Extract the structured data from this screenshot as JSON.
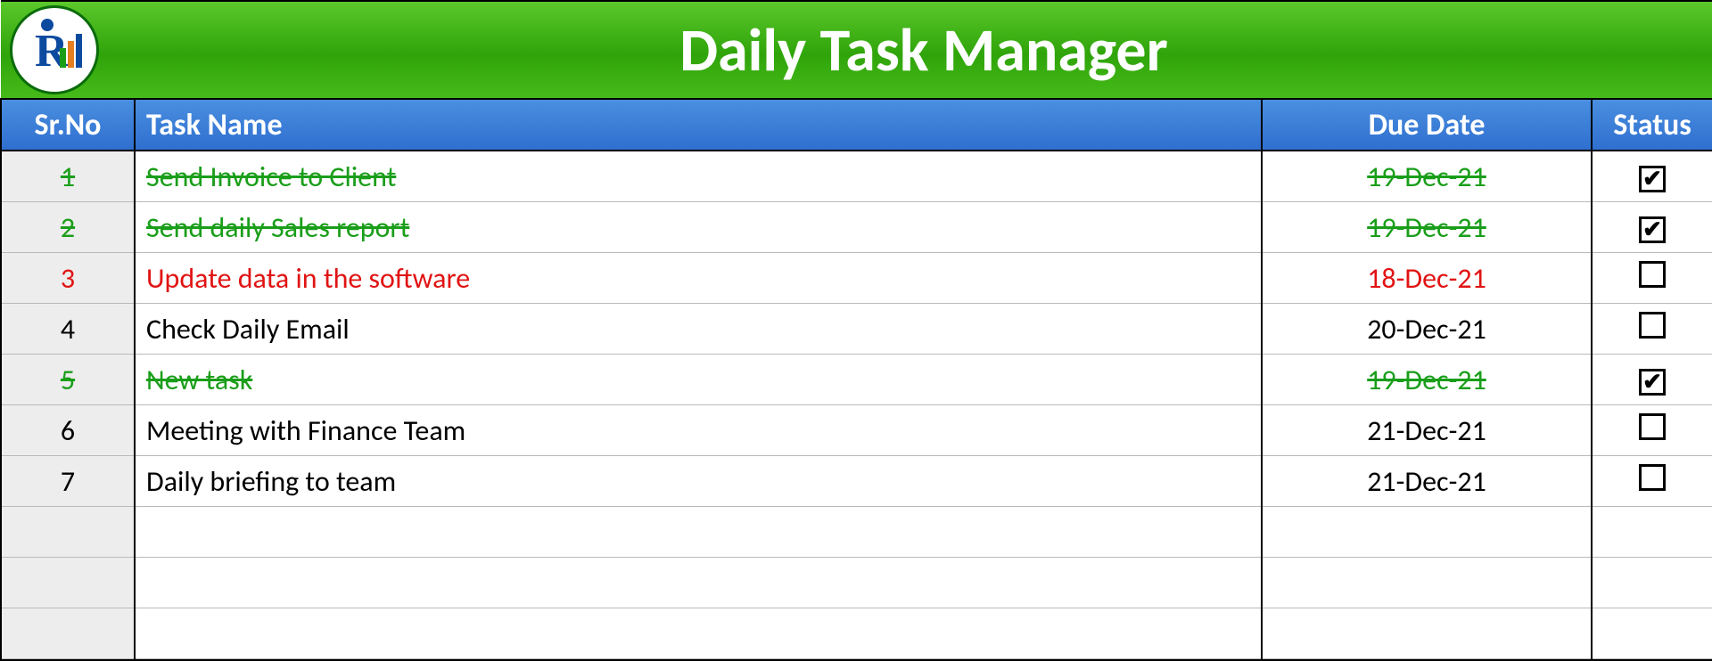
{
  "title": "Daily Task Manager",
  "columns": {
    "sr": "Sr.No",
    "task": "Task Name",
    "due": "Due Date",
    "stat": "Status"
  },
  "rows": [
    {
      "sr": "1",
      "task": "Send Invoice to Client",
      "due": "19-Dec-21",
      "checked": true,
      "state": "done"
    },
    {
      "sr": "2",
      "task": "Send daily Sales report",
      "due": "19-Dec-21",
      "checked": true,
      "state": "done"
    },
    {
      "sr": "3",
      "task": "Update data in the software",
      "due": "18-Dec-21",
      "checked": false,
      "state": "overdue"
    },
    {
      "sr": "4",
      "task": "Check Daily Email",
      "due": "20-Dec-21",
      "checked": false,
      "state": "normal"
    },
    {
      "sr": "5",
      "task": "New task",
      "due": "19-Dec-21",
      "checked": true,
      "state": "done"
    },
    {
      "sr": "6",
      "task": "Meeting with Finance Team",
      "due": "21-Dec-21",
      "checked": false,
      "state": "normal"
    },
    {
      "sr": "7",
      "task": "Daily briefing to team",
      "due": "21-Dec-21",
      "checked": false,
      "state": "normal"
    }
  ],
  "blank_rows": 3,
  "checkmark": "✔"
}
